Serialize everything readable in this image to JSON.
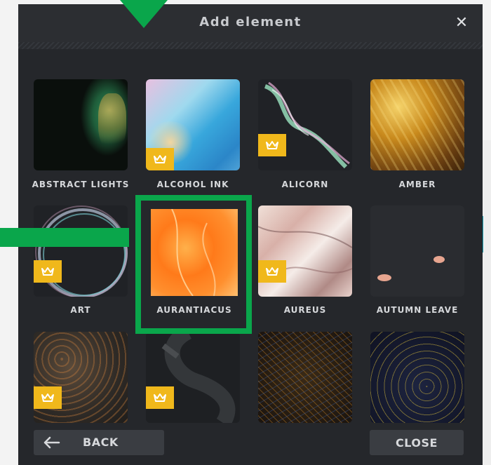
{
  "dialog": {
    "title": "Add element",
    "close_icon": "✕",
    "back_label": "BACK",
    "close_label": "CLOSE"
  },
  "elements": [
    {
      "label": "ABSTRACT LIGHTS",
      "premium": false
    },
    {
      "label": "ALCOHOL INK",
      "premium": true
    },
    {
      "label": "ALICORN",
      "premium": true
    },
    {
      "label": "AMBER",
      "premium": false
    },
    {
      "label": "ART",
      "premium": true
    },
    {
      "label": "AURANTIACUS",
      "premium": false,
      "highlighted": true
    },
    {
      "label": "AUREUS",
      "premium": true
    },
    {
      "label": "AUTUMN LEAVE",
      "premium": false
    },
    {
      "label": "",
      "premium": true
    },
    {
      "label": "",
      "premium": true
    },
    {
      "label": "",
      "premium": false
    },
    {
      "label": "",
      "premium": false
    }
  ],
  "colors": {
    "dialog_bg": "#25272b",
    "header_bg": "#2c2e32",
    "premium_badge": "#f0b81b",
    "annotation_green": "#0aa64b"
  },
  "icons": {
    "premium": "crown-icon",
    "back": "arrow-left-icon",
    "close": "close-icon"
  }
}
